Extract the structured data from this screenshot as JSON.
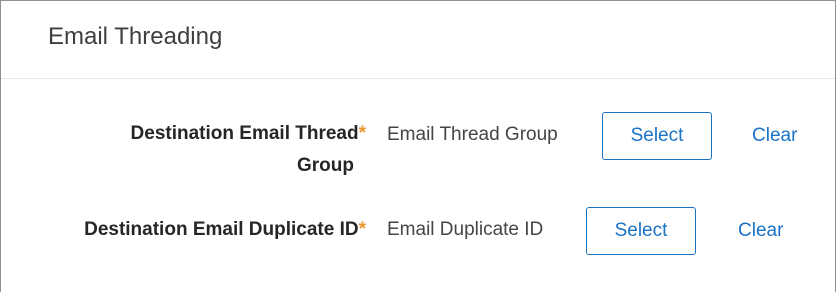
{
  "panel": {
    "title": "Email Threading"
  },
  "fields": [
    {
      "label_line1": "Destination Email Thread",
      "label_line2": "Group",
      "required_marker": "*",
      "value": "Email Thread Group",
      "select_label": "Select",
      "clear_label": "Clear"
    },
    {
      "label_line1": "Destination Email Duplicate ID",
      "required_marker": "*",
      "value": "Email Duplicate ID",
      "select_label": "Select",
      "clear_label": "Clear"
    }
  ],
  "colors": {
    "accent": "#1a73c7",
    "required": "#e8972e",
    "divider": "#dde8f3"
  }
}
